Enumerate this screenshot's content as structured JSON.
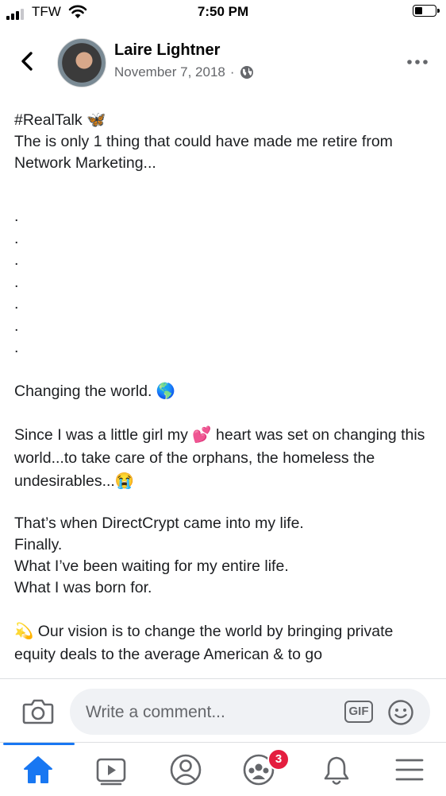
{
  "status_bar": {
    "carrier": "TFW",
    "time": "7:50 PM"
  },
  "post": {
    "author": "Laire Lightner",
    "date": "November 7, 2018",
    "separator": "·",
    "paragraphs": [
      "#RealTalk 🦋\nThe is only 1 thing that could have made me retire from Network Marketing...",
      ".\n.\n.\n.\n.\n.\n.",
      "Changing the world. 🌎",
      "Since I was a little girl my 💕 heart was set on changing this world...to take care of the orphans, the homeless the undesirables...😭",
      "That’s when DirectCrypt came into my life.\nFinally.\nWhat I’ve been waiting for my entire life.\nWhat I was born for.",
      "💫 Our vision is to change the world by bringing private equity deals to the average American & to go"
    ]
  },
  "comment_bar": {
    "placeholder": "Write a comment...",
    "gif_label": "GIF"
  },
  "tab_bar": {
    "groups_badge": "3"
  },
  "icons": {
    "back": "chevron-left-icon",
    "more": "more-horizontal-icon",
    "privacy": "globe-icon",
    "camera": "camera-icon",
    "emoji": "smiley-icon",
    "tabs": [
      "home-icon",
      "watch-icon",
      "profile-icon",
      "groups-icon",
      "bell-icon",
      "menu-icon"
    ]
  },
  "colors": {
    "accent": "#1877f2",
    "badge": "#e41e3f",
    "secondary_text": "#65676b"
  }
}
